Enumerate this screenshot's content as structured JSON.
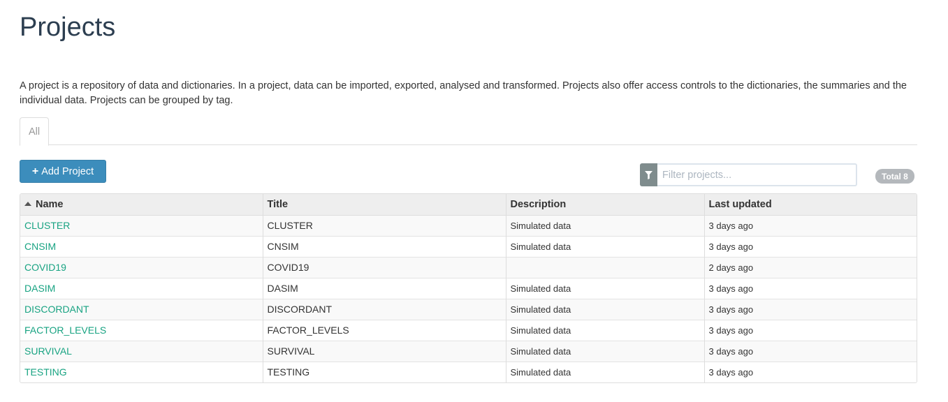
{
  "page": {
    "title": "Projects",
    "intro": "A project is a repository of data and dictionaries. In a project, data can be imported, exported, analysed and transformed. Projects also offer access controls to the dictionaries, the summaries and the individual data. Projects can be grouped by tag."
  },
  "tabs": [
    {
      "label": "All",
      "active": true
    }
  ],
  "toolbar": {
    "add_label": "Add Project",
    "add_icon": "plus-icon",
    "filter_icon": "filter-icon",
    "filter_placeholder": "Filter projects...",
    "filter_value": "",
    "total_label": "Total 8"
  },
  "table": {
    "columns": [
      "Name",
      "Title",
      "Description",
      "Last updated"
    ],
    "sort": {
      "column": "Name",
      "direction": "ascending"
    },
    "rows": [
      {
        "name": "CLUSTER",
        "title": "CLUSTER",
        "description": "Simulated data",
        "updated": "3 days ago"
      },
      {
        "name": "CNSIM",
        "title": "CNSIM",
        "description": "Simulated data",
        "updated": "3 days ago"
      },
      {
        "name": "COVID19",
        "title": "COVID19",
        "description": "",
        "updated": "2 days ago"
      },
      {
        "name": "DASIM",
        "title": "DASIM",
        "description": "Simulated data",
        "updated": "3 days ago"
      },
      {
        "name": "DISCORDANT",
        "title": "DISCORDANT",
        "description": "Simulated data",
        "updated": "3 days ago"
      },
      {
        "name": "FACTOR_LEVELS",
        "title": "FACTOR_LEVELS",
        "description": "Simulated data",
        "updated": "3 days ago"
      },
      {
        "name": "SURVIVAL",
        "title": "SURVIVAL",
        "description": "Simulated data",
        "updated": "3 days ago"
      },
      {
        "name": "TESTING",
        "title": "TESTING",
        "description": "Simulated data",
        "updated": "3 days ago"
      }
    ]
  },
  "colors": {
    "link": "#18a382",
    "primary_button": "#3c8dbc",
    "title": "#2c3e50",
    "badge": "#b4b8bc",
    "filter_addon": "#7f8c8d"
  }
}
